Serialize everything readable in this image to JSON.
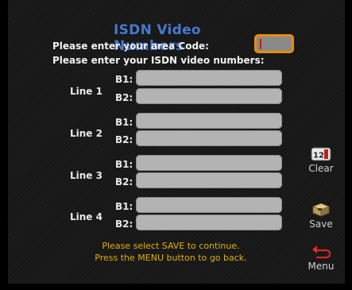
{
  "title": "ISDN Video Numbers",
  "prompts": {
    "area_code": "Please enter your area Code:",
    "isdn_numbers": "Please enter your ISDN video numbers:"
  },
  "area_code_value": "",
  "lines": [
    {
      "label": "Line 1",
      "b1_label": "B1:",
      "b2_label": "B2:",
      "b1_value": "",
      "b2_value": ""
    },
    {
      "label": "Line 2",
      "b1_label": "B1:",
      "b2_label": "B2:",
      "b1_value": "",
      "b2_value": ""
    },
    {
      "label": "Line 3",
      "b1_label": "B1:",
      "b2_label": "B2:",
      "b1_value": "",
      "b2_value": ""
    },
    {
      "label": "Line 4",
      "b1_label": "B1:",
      "b2_label": "B2:",
      "b1_value": "",
      "b2_value": ""
    }
  ],
  "footer": {
    "line1": "Please select SAVE to continue.",
    "line2": "Press the MENU button to go back."
  },
  "side_buttons": {
    "clear": {
      "label": "Clear",
      "icon": "clear-icon",
      "icon_text": "12"
    },
    "save": {
      "label": "Save",
      "icon": "save-icon"
    },
    "menu": {
      "label": "Menu",
      "icon": "back-arrow-icon"
    }
  },
  "colors": {
    "title": "#4a78c8",
    "highlight": "#e88d0c",
    "footer_text": "#e0b000",
    "field": "#b3b3b3"
  }
}
